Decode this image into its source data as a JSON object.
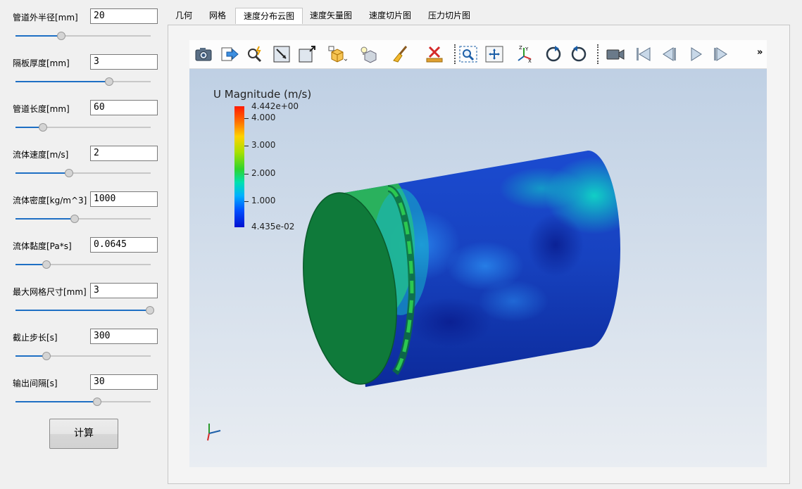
{
  "params": [
    {
      "label": "管道外半径[mm]",
      "value": "20",
      "slider": 0.33
    },
    {
      "label": "隔板厚度[mm]",
      "value": "3",
      "slider": 0.69
    },
    {
      "label": "管道长度[mm]",
      "value": "60",
      "slider": 0.19
    },
    {
      "label": "流体速度[m/s]",
      "value": "2",
      "slider": 0.39
    },
    {
      "label": "流体密度[kg/m^3]",
      "value": "1000",
      "slider": 0.43
    },
    {
      "label": "流体黏度[Pa*s]",
      "value": "0.0645",
      "slider": 0.22
    },
    {
      "label": "最大网格尺寸[mm]",
      "value": "3",
      "slider": 1.0
    },
    {
      "label": "截止步长[s]",
      "value": "300",
      "slider": 0.22
    },
    {
      "label": "输出间隔[s]",
      "value": "30",
      "slider": 0.6
    }
  ],
  "calc_label": "计算",
  "tabs": [
    "几何",
    "网格",
    "速度分布云图",
    "速度矢量图",
    "速度切片图",
    "压力切片图"
  ],
  "active_tab": 2,
  "toolbar": {
    "icons": [
      "camera-icon",
      "export-icon",
      "pick-icon",
      "select-point-icon",
      "select-cell-icon",
      "render-view-icon",
      "light-icon",
      "clear-icon",
      "delete-icon",
      "zoom-box-icon",
      "reset-camera-icon",
      "axes-orient-icon",
      "rotate-cw-icon",
      "rotate-ccw-icon",
      "record-camera-icon",
      "first-frame-icon",
      "previous-frame-icon",
      "play-icon",
      "next-frame-icon"
    ],
    "more": "»"
  },
  "colorbar": {
    "title": "U Magnitude (m/s)",
    "max_label": "4.442e+00",
    "min_label": "4.435e-02",
    "min": 0.04435,
    "max": 4.442,
    "ticks": [
      "4.000",
      "3.000",
      "2.000",
      "1.000"
    ],
    "tick_values": [
      4.0,
      3.0,
      2.0,
      1.0
    ]
  }
}
